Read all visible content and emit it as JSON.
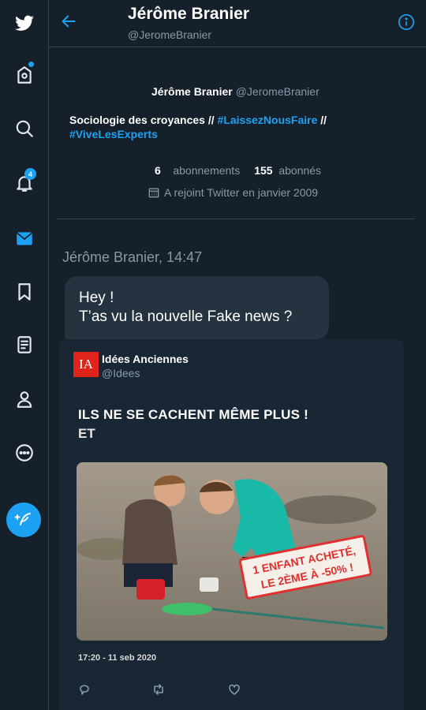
{
  "header": {
    "name": "Jérôme Branier",
    "handle": "@JeromeBranier"
  },
  "profile": {
    "name": "Jérôme Branier",
    "handle": "@JeromeBranier",
    "bio_prefix": "Sociologie des croyances // ",
    "bio_tag1": "#LaissezNousFaire",
    "bio_sep": " // ",
    "bio_tag2": "#ViveLesExperts",
    "following_count": "6",
    "following_label": "abonnements",
    "followers_count": "155",
    "followers_label": "abonnés",
    "joined": "A rejoint Twitter en janvier 2009"
  },
  "sidebar": {
    "notification_badge": "4"
  },
  "message": {
    "meta": "Jérôme Branier, 14:47",
    "line1": "Hey !",
    "line2": "T’as vu la nouvelle Fake news ?"
  },
  "shared_tweet": {
    "logo_text": "IA",
    "author": "Idées Anciennes",
    "handle": "@Idees",
    "title": "ILS NE SE CACHENT MÊME PLUS !",
    "subtitle": "ET",
    "stamp_line1": "1 ENFANT ACHETÉ,",
    "stamp_line2": "LE 2ÈME À -50% !",
    "timestamp": "17:20 - 11 seb 2020"
  },
  "colors": {
    "background": "#15202b",
    "accent": "#1da1f2",
    "bubble": "#253341",
    "muted": "#8899a6",
    "logo_red": "#e0231b"
  }
}
